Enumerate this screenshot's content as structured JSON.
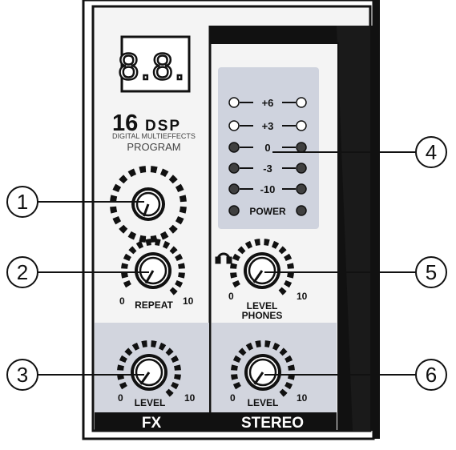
{
  "display": {
    "digits": "8.8."
  },
  "branding": {
    "model": "16",
    "dsp": "DSP",
    "subtitle": "DIGITAL MULTIEFFECTS",
    "program_label": "PROGRAM"
  },
  "meter": {
    "labels": [
      "+6",
      "+3",
      "0",
      "-3",
      "-10",
      "POWER"
    ],
    "lit": [
      false,
      false,
      true,
      true,
      true,
      true
    ]
  },
  "knobs": {
    "program": {
      "min_label": "",
      "max_label": "",
      "label": ""
    },
    "repeat": {
      "min_label": "0",
      "max_label": "10",
      "label": "REPEAT"
    },
    "fx_level": {
      "min_label": "0",
      "max_label": "10",
      "label": "LEVEL"
    },
    "phones_level": {
      "min_label": "0",
      "max_label": "10",
      "label": "LEVEL",
      "label2": "PHONES"
    },
    "stereo_level": {
      "min_label": "0",
      "max_label": "10",
      "label": "LEVEL"
    }
  },
  "sections": {
    "fx": "FX",
    "stereo": "STEREO"
  },
  "callouts": [
    "1",
    "2",
    "3",
    "4",
    "5",
    "6"
  ],
  "colors": {
    "panel": "#f2f2f2",
    "shade": "#cfd2dc",
    "ink": "#141414",
    "led_on": "#404040"
  }
}
